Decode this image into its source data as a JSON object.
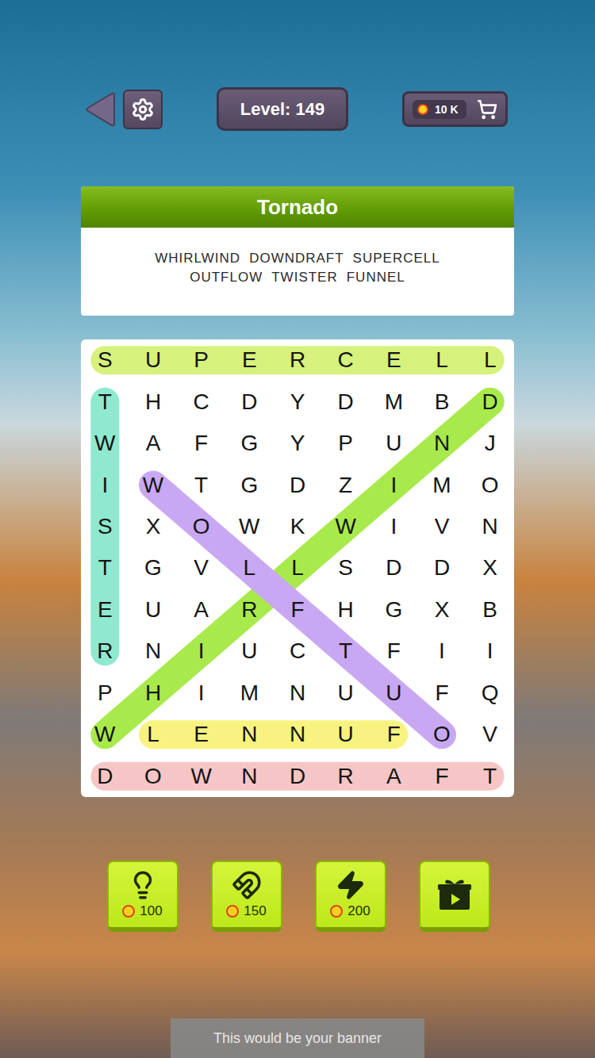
{
  "top_bar": {
    "level_label": "Level: 149",
    "coins": "10 K"
  },
  "category": {
    "title": "Tornado",
    "lines": [
      [
        "WHIRLWIND",
        "DOWNDRAFT",
        "SUPERCELL"
      ],
      [
        "OUTFLOW",
        "TWISTER",
        "FUNNEL"
      ]
    ]
  },
  "grid": {
    "rows": [
      [
        "S",
        "U",
        "P",
        "E",
        "R",
        "C",
        "E",
        "L",
        "L"
      ],
      [
        "T",
        "H",
        "C",
        "D",
        "Y",
        "D",
        "M",
        "B",
        "D"
      ],
      [
        "W",
        "A",
        "F",
        "G",
        "Y",
        "P",
        "U",
        "N",
        "J"
      ],
      [
        "I",
        "W",
        "T",
        "G",
        "D",
        "Z",
        "I",
        "M",
        "O"
      ],
      [
        "S",
        "X",
        "O",
        "W",
        "K",
        "W",
        "I",
        "V",
        "N"
      ],
      [
        "T",
        "G",
        "V",
        "L",
        "L",
        "S",
        "D",
        "D",
        "X"
      ],
      [
        "E",
        "U",
        "A",
        "R",
        "F",
        "H",
        "G",
        "X",
        "B"
      ],
      [
        "R",
        "N",
        "I",
        "U",
        "C",
        "T",
        "F",
        "I",
        "I"
      ],
      [
        "P",
        "H",
        "I",
        "M",
        "N",
        "U",
        "U",
        "F",
        "Q"
      ],
      [
        "W",
        "L",
        "E",
        "N",
        "N",
        "U",
        "F",
        "O",
        "V"
      ],
      [
        "D",
        "O",
        "W",
        "N",
        "D",
        "R",
        "A",
        "F",
        "T"
      ]
    ]
  },
  "highlights": [
    {
      "word": "SUPERCELL",
      "found": true,
      "color": "#d6f27c",
      "start": [
        0,
        0
      ],
      "end": [
        0,
        8
      ]
    },
    {
      "word": "TWISTER",
      "found": true,
      "color": "#8fe9cf",
      "start": [
        1,
        0
      ],
      "end": [
        7,
        0
      ]
    },
    {
      "word": "WHIRLWIND",
      "found": true,
      "color": "#a8ea4c",
      "start": [
        9,
        0
      ],
      "end": [
        1,
        8
      ]
    },
    {
      "word": "OUTFLOW",
      "found": true,
      "color": "#c9a8f3",
      "start": [
        3,
        1
      ],
      "end": [
        9,
        7
      ]
    },
    {
      "word": "FUNNEL",
      "found": true,
      "color": "#f8f380",
      "start": [
        9,
        1
      ],
      "end": [
        9,
        6
      ]
    },
    {
      "word": "DOWNDRAFT",
      "found": true,
      "color": "#f6c6c6",
      "start": [
        10,
        0
      ],
      "end": [
        10,
        8
      ]
    }
  ],
  "boosters": [
    {
      "kind": "hint",
      "price": "100"
    },
    {
      "kind": "magnet",
      "price": "150"
    },
    {
      "kind": "lightning",
      "price": "200"
    },
    {
      "kind": "video"
    }
  ],
  "banner": "This would be your banner"
}
